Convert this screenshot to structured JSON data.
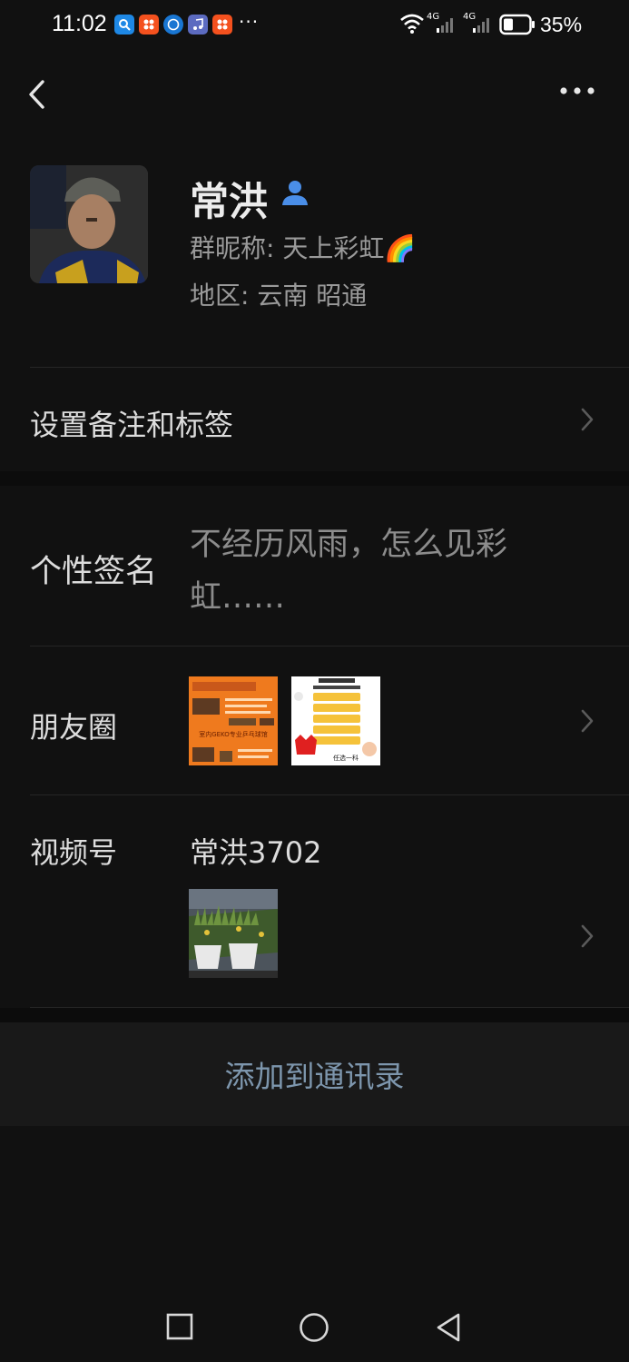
{
  "status_bar": {
    "time": "11:02",
    "overflow": "···",
    "network_1": "4G",
    "network_2": "4G",
    "battery": "35%"
  },
  "header": {
    "back_icon": "chevron-left-icon",
    "more_icon": "more-horizontal-icon"
  },
  "profile": {
    "name": "常洪",
    "nickname": "群昵称: 天上彩虹🌈",
    "region": "地区: 云南  昭通"
  },
  "remark_row": {
    "label": "设置备注和标签"
  },
  "signature_row": {
    "label": "个性签名",
    "value": "不经历风雨，怎么见彩虹……"
  },
  "moments_row": {
    "label": "朋友圈",
    "thumb1_text": "室内GEKO专业乒乓球馆",
    "thumb2_text": "任选一科"
  },
  "channels_row": {
    "label": "视频号",
    "value": "常洪3702"
  },
  "actions": {
    "add_contact": "添加到通讯录"
  },
  "colors": {
    "background": "#111111",
    "accent_link": "#7d96ad",
    "verified_icon": "#4a8ee8"
  }
}
